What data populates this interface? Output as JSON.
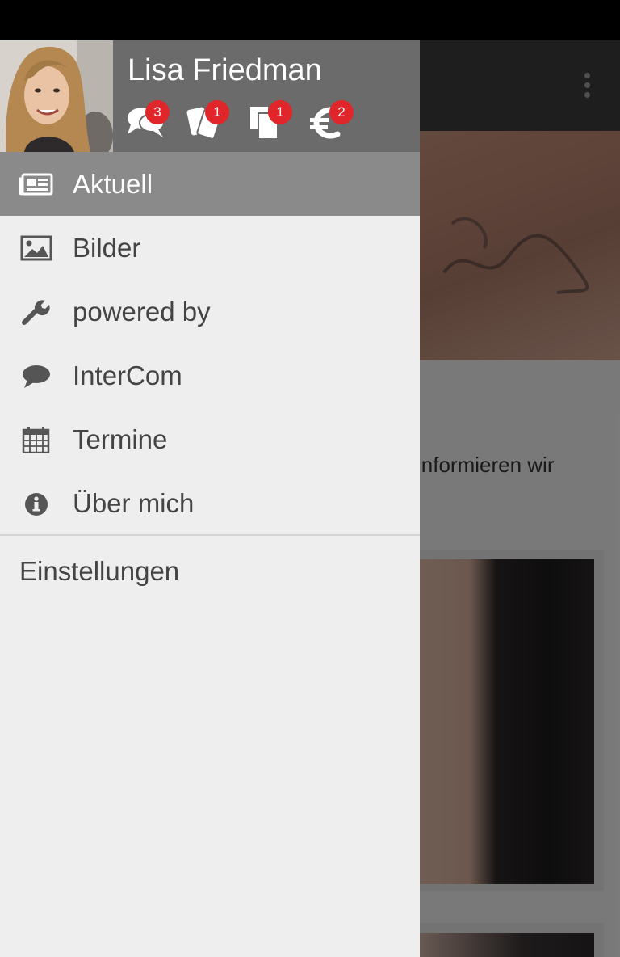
{
  "user": {
    "name": "Lisa Friedman"
  },
  "header_icons": [
    {
      "name": "chat-bubbles-icon",
      "badge": "3"
    },
    {
      "name": "tickets-icon",
      "badge": "1"
    },
    {
      "name": "documents-icon",
      "badge": "1"
    },
    {
      "name": "euro-icon",
      "badge": "2"
    }
  ],
  "nav": {
    "items": [
      {
        "label": "Aktuell",
        "icon": "newspaper-icon",
        "active": true
      },
      {
        "label": "Bilder",
        "icon": "image-icon"
      },
      {
        "label": "powered by",
        "icon": "wrench-icon"
      },
      {
        "label": "InterCom",
        "icon": "speech-bubble-icon"
      },
      {
        "label": "Termine",
        "icon": "calendar-icon"
      },
      {
        "label": "Über mich",
        "icon": "info-icon"
      }
    ],
    "settings_label": "Einstellungen"
  },
  "background": {
    "text_fragment": "informieren wir"
  },
  "colors": {
    "accent_badge": "#e0262b",
    "header_bg": "#6b6b6b",
    "active_item_bg": "#8a8a8a",
    "drawer_bg": "#eeeeee"
  }
}
